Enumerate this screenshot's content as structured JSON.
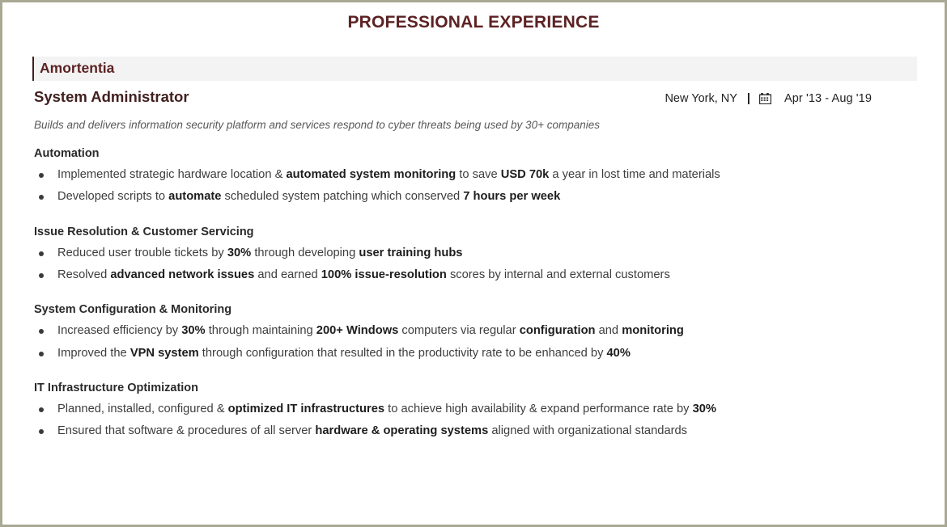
{
  "document": {
    "section_title": "PROFESSIONAL EXPERIENCE",
    "accent_color": "#5c2223",
    "band_color": "#f3f3f3",
    "border_color": "#a8a893"
  },
  "experience": {
    "company": "Amortentia",
    "job_title": "System Administrator",
    "location": "New York, NY",
    "separator": "|",
    "calendar_icon": "calendar-icon",
    "dates": "Apr '13 -  Aug '19",
    "summary": "Builds and delivers information security platform and services respond to cyber threats being used by 30+ companies",
    "groups": [
      {
        "heading": "Automation",
        "bullets": [
          [
            {
              "text": "Implemented strategic hardware location & ",
              "bold": false
            },
            {
              "text": "automated system monitoring",
              "bold": true
            },
            {
              "text": " to save ",
              "bold": false
            },
            {
              "text": "USD 70k",
              "bold": true
            },
            {
              "text": " a year in lost time and materials",
              "bold": false
            }
          ],
          [
            {
              "text": "Developed scripts to ",
              "bold": false
            },
            {
              "text": "automate",
              "bold": true
            },
            {
              "text": " scheduled system patching which conserved ",
              "bold": false
            },
            {
              "text": "7 hours per week",
              "bold": true
            }
          ]
        ]
      },
      {
        "heading": "Issue Resolution & Customer Servicing",
        "bullets": [
          [
            {
              "text": "Reduced user trouble tickets by ",
              "bold": false
            },
            {
              "text": "30%",
              "bold": true
            },
            {
              "text": " through developing ",
              "bold": false
            },
            {
              "text": "user training hubs",
              "bold": true
            }
          ],
          [
            {
              "text": "Resolved ",
              "bold": false
            },
            {
              "text": "advanced network issues",
              "bold": true
            },
            {
              "text": " and earned ",
              "bold": false
            },
            {
              "text": "100% issue-resolution",
              "bold": true
            },
            {
              "text": " scores by internal and external customers",
              "bold": false
            }
          ]
        ]
      },
      {
        "heading": "System Configuration & Monitoring",
        "bullets": [
          [
            {
              "text": "Increased efficiency by ",
              "bold": false
            },
            {
              "text": "30%",
              "bold": true
            },
            {
              "text": " through maintaining ",
              "bold": false
            },
            {
              "text": "200+ Windows",
              "bold": true
            },
            {
              "text": " computers via regular ",
              "bold": false
            },
            {
              "text": "configuration",
              "bold": true
            },
            {
              "text": " and ",
              "bold": false
            },
            {
              "text": "monitoring",
              "bold": true
            }
          ],
          [
            {
              "text": "Improved the ",
              "bold": false
            },
            {
              "text": "VPN system",
              "bold": true
            },
            {
              "text": " through configuration that resulted in the productivity rate to be enhanced by ",
              "bold": false
            },
            {
              "text": "40%",
              "bold": true
            }
          ]
        ]
      },
      {
        "heading": "IT Infrastructure Optimization",
        "bullets": [
          [
            {
              "text": "Planned, installed, configured & ",
              "bold": false
            },
            {
              "text": "optimized IT infrastructures",
              "bold": true
            },
            {
              "text": " to achieve high availability & expand performance rate by ",
              "bold": false
            },
            {
              "text": "30%",
              "bold": true
            }
          ],
          [
            {
              "text": "Ensured that software & procedures of all server ",
              "bold": false
            },
            {
              "text": "hardware & operating systems",
              "bold": true
            },
            {
              "text": " aligned with organizational standards",
              "bold": false
            }
          ]
        ]
      }
    ]
  }
}
